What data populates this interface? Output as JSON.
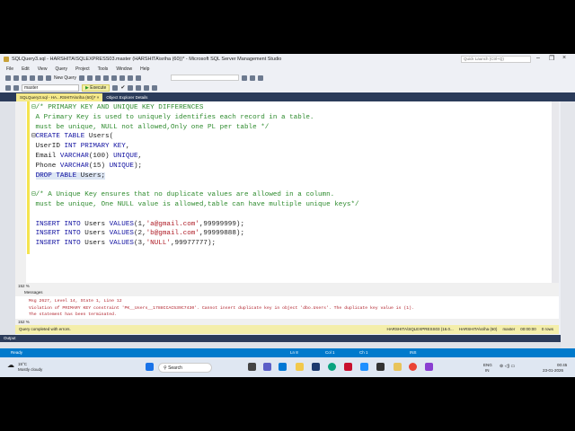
{
  "window": {
    "title": "SQLQuery3.sql - HARSHITA\\SQLEXPRESS03.master (HARSHITA\\sriha (60))* - Microsoft SQL Server Management Studio",
    "quick_launch": "Quick Launch (Ctrl+Q)"
  },
  "menu": [
    "File",
    "Edit",
    "View",
    "Query",
    "Project",
    "Tools",
    "Window",
    "Help"
  ],
  "toolbar": {
    "new_query": "New Query",
    "database": "master",
    "execute": "Execute"
  },
  "tabs": [
    {
      "label": "SQLQuery3.sql - HA...RSHITA\\sriha (60))*"
    },
    {
      "label": "Object Explorer Details"
    }
  ],
  "editor": {
    "zoom": "152 %"
  },
  "messages": {
    "header": "Messages",
    "lines": [
      "Msg 2627, Level 14, State 1, Line 12",
      "Violation of PRIMARY KEY constraint 'PK__Users__1788CCAC539C7430'. Cannot insert duplicate key in object 'dbo.Users'. The duplicate key value is (1).",
      "The statement has been terminated."
    ],
    "zoom": "152 %"
  },
  "query_status": {
    "message": "Query completed with errors.",
    "server": "HARSHITA\\SQLEXPRESS03 (16.0...",
    "user": "HARSHITA\\sriha (60)",
    "db": "master",
    "time": "00:00:00",
    "rows": "0 rows"
  },
  "output": {
    "title": "Output"
  },
  "statusbar": {
    "ready": "Ready",
    "ln": "Ln 8",
    "col": "Col 1",
    "ch": "Ch 1",
    "ins": "INS"
  },
  "taskbar": {
    "temp": "15°C",
    "weather": "Mostly cloudy",
    "search": "Search",
    "lang1": "ENG",
    "lang2": "IN",
    "time": "00:45",
    "date": "23-01-2026"
  },
  "colors": {
    "accent": "#007acc",
    "tab_active": "#f5e98a",
    "header": "#2b3b5a"
  }
}
